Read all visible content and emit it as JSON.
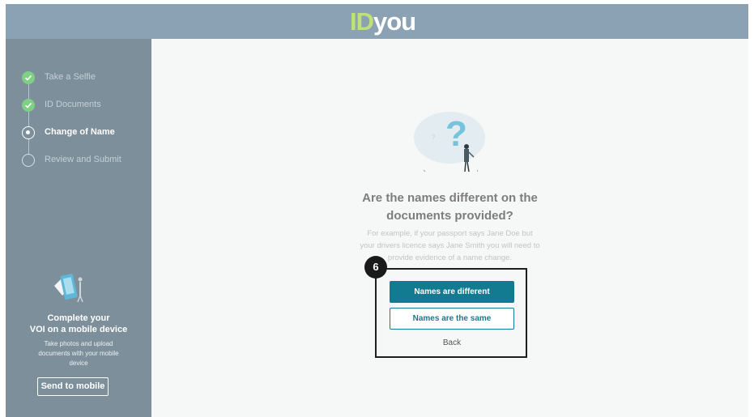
{
  "header": {
    "logo_id": "ID",
    "logo_you": "you"
  },
  "steps": [
    {
      "label": "Take a Selfie",
      "status": "complete"
    },
    {
      "label": "ID Documents",
      "status": "complete"
    },
    {
      "label": "Change of Name",
      "status": "current"
    },
    {
      "label": "Review and Submit",
      "status": "pending"
    }
  ],
  "mobile_promo": {
    "title_line1": "Complete your",
    "title_line2": "VOI on a mobile device",
    "text_line1": "Take photos and upload",
    "text_line2": "documents with your mobile",
    "text_line3": "device",
    "button_label": "Send to mobile"
  },
  "main": {
    "question_line1": "Are the names different on the",
    "question_line2": "documents provided?",
    "helper_line1": "For example, if your passport says Jane Doe but",
    "helper_line2": "your drivers licence says Jane Smith you will need to",
    "helper_line3": "provide evidence of a name change.",
    "primary_button": "Names are different",
    "secondary_button": "Names are the same",
    "back_label": "Back"
  },
  "annotation": {
    "badge": "6"
  },
  "colors": {
    "header_bg": "#8aa2b3",
    "sidebar_bg": "#7c8f9a",
    "accent": "#127b91",
    "logo_green": "#bfe07a",
    "step_complete": "#7fcf84"
  },
  "icons": {
    "step_complete": "check-icon",
    "mobile": "mobile-device-illustration",
    "question": "question-mark-illustration"
  }
}
